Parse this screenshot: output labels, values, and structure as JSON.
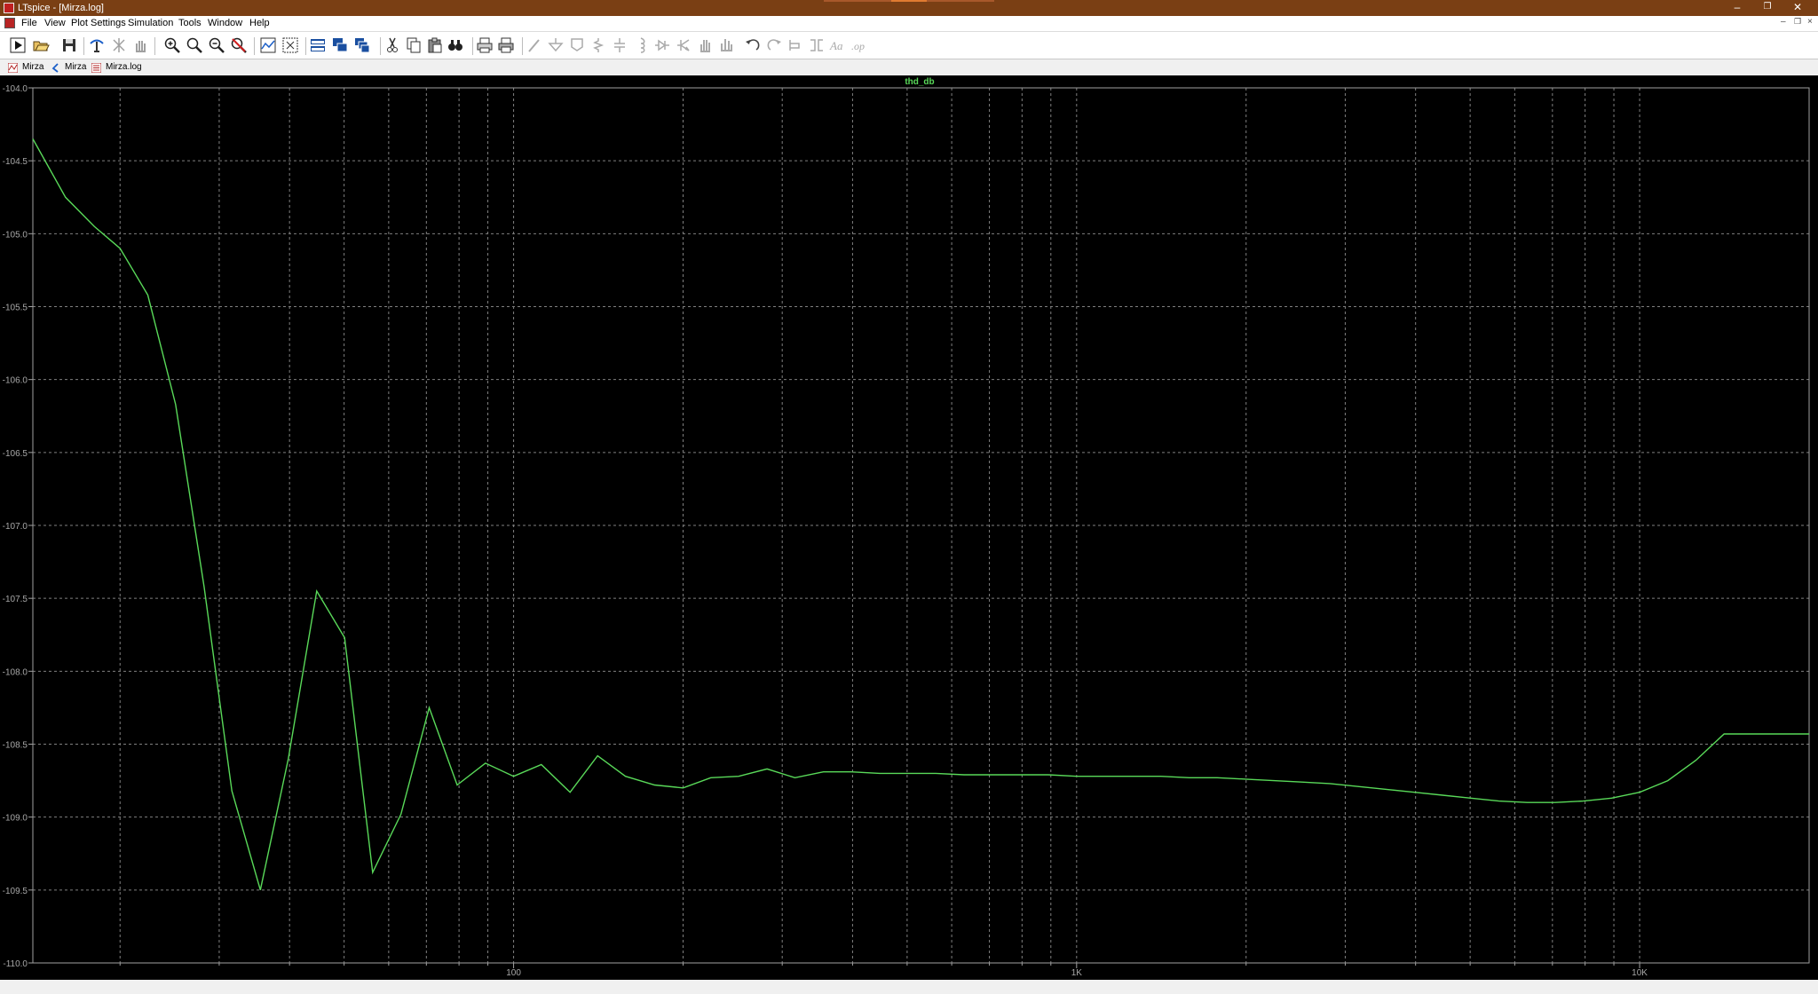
{
  "window": {
    "title": "LTspice - [Mirza.log]"
  },
  "window_controls": {
    "minimize": "–",
    "restore": "❐",
    "close": "✕"
  },
  "menubar": {
    "items": [
      "File",
      "View",
      "Plot Settings",
      "Simulation",
      "Tools",
      "Window",
      "Help"
    ],
    "mdi_controls": {
      "minimize": "–",
      "restore": "❐",
      "close": "×"
    }
  },
  "toolbar": {
    "tools": [
      "run-icon",
      "open-icon",
      "save-icon",
      "control-panel-icon",
      "halt-icon",
      "pan-hand-icon",
      "zoom-in-icon",
      "zoom-out-icon",
      "zoom-out-alt-icon",
      "zoom-cancel-icon",
      "autorange-icon",
      "autorange-y-icon",
      "tile-horizontal-icon",
      "cascade-icon",
      "tile-vertical-icon",
      "cut-icon",
      "copy-icon",
      "paste-icon",
      "find-icon",
      "print-icon",
      "print-preview-icon",
      "wire-icon",
      "ground-icon",
      "label-net-icon",
      "resistor-icon",
      "capacitor-icon",
      "inductor-icon",
      "diode-icon",
      "component-icon",
      "move-icon",
      "drag-icon",
      "undo-icon",
      "redo-icon",
      "rotate-icon",
      "mirror-icon",
      "text-icon",
      "spice-directive-icon"
    ]
  },
  "tabs": [
    {
      "label": "Mirza",
      "icon": "waveform-tab-icon"
    },
    {
      "label": "Mirza",
      "icon": "schematic-tab-icon"
    },
    {
      "label": "Mirza.log",
      "icon": "log-tab-icon"
    }
  ],
  "colors": {
    "background": "#000000",
    "grid": "#808080",
    "axis": "#a0a0a0",
    "trace": "#59d959",
    "titlebar": "#7a3f14"
  },
  "chart_data": {
    "type": "line",
    "title": "thd_db",
    "xlabel": "",
    "ylabel": "",
    "x_scale": "log",
    "xlim": [
      14,
      20000
    ],
    "ylim": [
      -110.0,
      -104.0
    ],
    "grid": true,
    "y_ticks": [
      -104.0,
      -104.5,
      -105.0,
      -105.5,
      -106.0,
      -106.5,
      -107.0,
      -107.5,
      -108.0,
      -108.5,
      -109.0,
      -109.5,
      -110.0
    ],
    "y_tick_labels": [
      "-104.0",
      "-104.5",
      "-105.0",
      "-105.5",
      "-106.0",
      "-106.5",
      "-107.0",
      "-107.5",
      "-108.0",
      "-108.5",
      "-109.0",
      "-109.5",
      "-110.0"
    ],
    "x_ticks": [
      100,
      1000,
      10000
    ],
    "x_tick_labels": [
      "100",
      "1K",
      "10K"
    ],
    "series": [
      {
        "name": "thd_db",
        "x": [
          14,
          16,
          18,
          20,
          22.4,
          25.1,
          28.2,
          31.6,
          35.5,
          39.8,
          44.7,
          50.1,
          56.2,
          63.1,
          70.8,
          79.4,
          89.1,
          100,
          112,
          126,
          141,
          158,
          178,
          200,
          224,
          251,
          282,
          316,
          355,
          398,
          447,
          501,
          562,
          631,
          708,
          794,
          891,
          1000,
          1122,
          1259,
          1413,
          1585,
          1778,
          1995,
          2239,
          2512,
          2818,
          3162,
          3548,
          3981,
          4467,
          5012,
          5623,
          6310,
          7079,
          7943,
          8913,
          10000,
          11220,
          12589,
          14125,
          15849,
          17783,
          20000
        ],
        "y": [
          -104.35,
          -104.75,
          -104.95,
          -105.1,
          -105.42,
          -106.17,
          -107.42,
          -108.82,
          -109.5,
          -108.6,
          -107.45,
          -107.77,
          -109.38,
          -108.98,
          -108.25,
          -108.78,
          -108.63,
          -108.72,
          -108.64,
          -108.83,
          -108.58,
          -108.72,
          -108.78,
          -108.8,
          -108.73,
          -108.72,
          -108.67,
          -108.73,
          -108.69,
          -108.69,
          -108.7,
          -108.7,
          -108.7,
          -108.71,
          -108.71,
          -108.71,
          -108.71,
          -108.72,
          -108.72,
          -108.72,
          -108.72,
          -108.73,
          -108.73,
          -108.74,
          -108.75,
          -108.76,
          -108.77,
          -108.79,
          -108.81,
          -108.83,
          -108.85,
          -108.87,
          -108.89,
          -108.9,
          -108.9,
          -108.89,
          -108.87,
          -108.83,
          -108.75,
          -108.61,
          -108.43,
          -108.43,
          -108.43,
          -108.43
        ]
      }
    ]
  }
}
